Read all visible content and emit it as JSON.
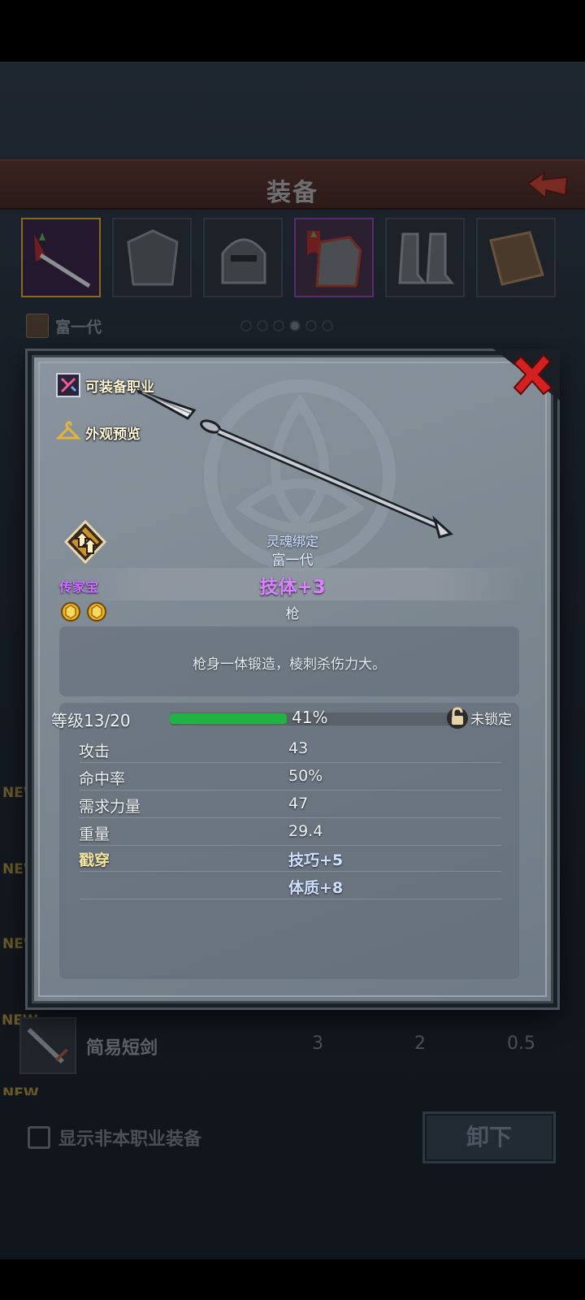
{
  "screen": {
    "title": "装备",
    "character_name": "富一代",
    "page_dots": {
      "count": 6,
      "active": 4
    },
    "list_items": [
      {
        "new_tag": "NEW",
        "name": "简易短剑",
        "values": [
          "3",
          "2",
          "0.5"
        ]
      }
    ],
    "new_tags": [
      "NEW",
      "NEW",
      "NEW",
      "NEW",
      "NEW"
    ],
    "show_other_class_label": "显示非本职业装备",
    "unequip_label": "卸下"
  },
  "item": {
    "equip_class_label": "可装备职业",
    "appearance_preview_label": "外观预览",
    "soulbind_label": "灵魂绑定",
    "soulbind_owner": "富一代",
    "rarity": "传家宝",
    "main_stat": "技体+3",
    "weapon_type": "枪",
    "description": "枪身一体锻造，棱刺杀伤力大。",
    "level_label": "等级13/20",
    "level_progress": 0.41,
    "level_percent": "41%",
    "lock_label": "未锁定",
    "stats": [
      {
        "label": "攻击",
        "value": "43"
      },
      {
        "label": "命中率",
        "value": "50%"
      },
      {
        "label": "需求力量",
        "value": "47"
      },
      {
        "label": "重量",
        "value": "29.4"
      }
    ],
    "pierce_label": "戳穿",
    "pierce_bonuses": [
      "技巧+5",
      "体质+8"
    ],
    "gem_count": 2
  },
  "colors": {
    "rarity_purple": "#c873ff",
    "main_stat_purple": "#d884ff",
    "progress_green": "#21b244",
    "close_red": "#d42020"
  }
}
